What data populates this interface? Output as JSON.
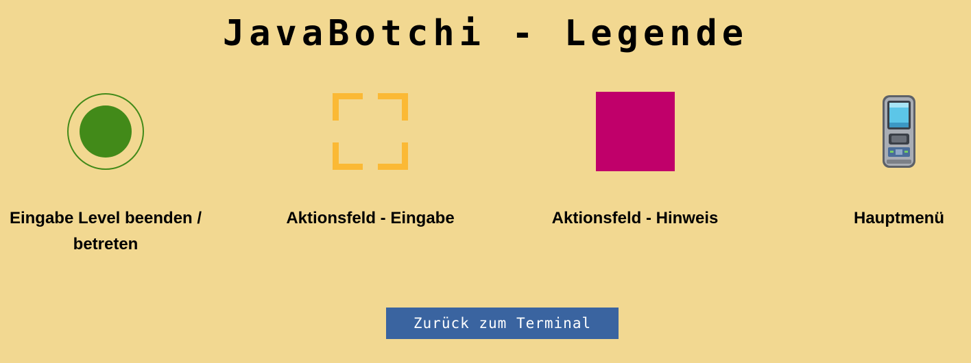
{
  "page": {
    "title": "JavaBotchi - Legende",
    "background": "#f2d891"
  },
  "legend": {
    "items": [
      {
        "label": "Eingabe Level beenden / betreten",
        "icon": "level-exit-circle-icon",
        "color": "#428a19"
      },
      {
        "label": "Aktionsfeld - Eingabe",
        "icon": "input-field-brackets-icon",
        "color": "#fbb935"
      },
      {
        "label": "Aktionsfeld - Hinweis",
        "icon": "hint-field-square-icon",
        "color": "#c0006a"
      },
      {
        "label": "Hauptmenü",
        "icon": "handheld-device-icon",
        "color": "#5cc6e8"
      }
    ]
  },
  "back_button": {
    "label": "Zurück zum Terminal",
    "color": "#3a64a0"
  }
}
